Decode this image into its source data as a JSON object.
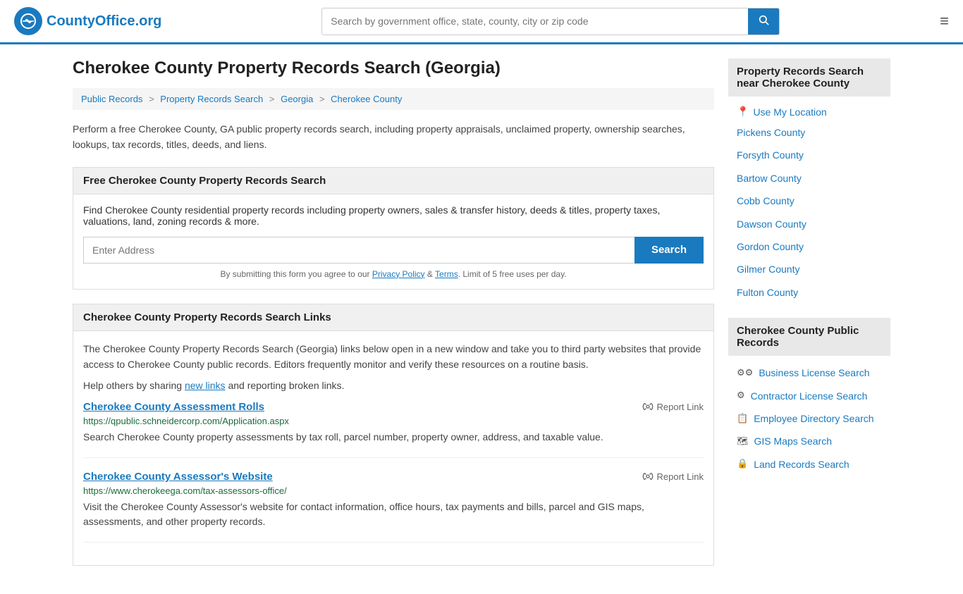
{
  "header": {
    "logo_text": "CountyOffice",
    "logo_org": ".org",
    "search_placeholder": "Search by government office, state, county, city or zip code",
    "hamburger_label": "≡"
  },
  "page": {
    "title": "Cherokee County Property Records Search (Georgia)",
    "breadcrumb": [
      {
        "label": "Public Records",
        "href": "#"
      },
      {
        "label": "Property Records Search",
        "href": "#"
      },
      {
        "label": "Georgia",
        "href": "#"
      },
      {
        "label": "Cherokee County",
        "href": "#"
      }
    ],
    "description": "Perform a free Cherokee County, GA public property records search, including property appraisals, unclaimed property, ownership searches, lookups, tax records, titles, deeds, and liens."
  },
  "free_search_section": {
    "header": "Free Cherokee County Property Records Search",
    "body": "Find Cherokee County residential property records including property owners, sales & transfer history, deeds & titles, property taxes, valuations, land, zoning records & more.",
    "address_placeholder": "Enter Address",
    "search_button": "Search",
    "form_note_before": "By submitting this form you agree to our ",
    "privacy_label": "Privacy Policy",
    "form_note_and": " & ",
    "terms_label": "Terms",
    "form_note_after": ". Limit of 5 free uses per day."
  },
  "links_section": {
    "header": "Cherokee County Property Records Search Links",
    "description": "The Cherokee County Property Records Search (Georgia) links below open in a new window and take you to third party websites that provide access to Cherokee County public records. Editors frequently monitor and verify these resources on a routine basis.",
    "help_before": "Help others by sharing ",
    "help_new_links": "new links",
    "help_after": " and reporting broken links.",
    "links": [
      {
        "title": "Cherokee County Assessment Rolls",
        "url": "https://qpublic.schneidercorp.com/Application.aspx",
        "description": "Search Cherokee County property assessments by tax roll, parcel number, property owner, address, and taxable value.",
        "report_label": "Report Link"
      },
      {
        "title": "Cherokee County Assessor's Website",
        "url": "https://www.cherokeega.com/tax-assessors-office/",
        "description": "Visit the Cherokee County Assessor's website for contact information, office hours, tax payments and bills, parcel and GIS maps, assessments, and other property records.",
        "report_label": "Report Link"
      }
    ]
  },
  "sidebar": {
    "nearby_header": "Property Records Search near Cherokee County",
    "use_location": "Use My Location",
    "nearby_counties": [
      "Pickens County",
      "Forsyth County",
      "Bartow County",
      "Cobb County",
      "Dawson County",
      "Gordon County",
      "Gilmer County",
      "Fulton County"
    ],
    "public_records_header": "Cherokee County Public Records",
    "public_records_links": [
      {
        "icon": "⚙⚙",
        "label": "Business License Search"
      },
      {
        "icon": "⚙",
        "label": "Contractor License Search"
      },
      {
        "icon": "📋",
        "label": "Employee Directory Search"
      },
      {
        "icon": "🗺",
        "label": "GIS Maps Search"
      },
      {
        "icon": "🔒",
        "label": "Land Records Search"
      }
    ]
  }
}
